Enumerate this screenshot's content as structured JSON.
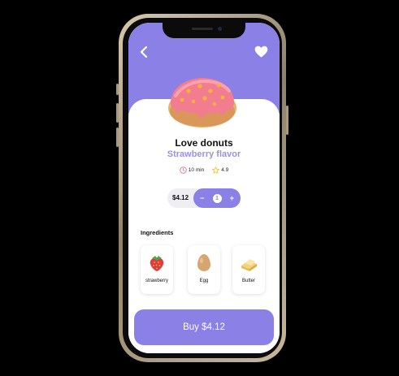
{
  "colors": {
    "accent": "#8b80e6",
    "subtitle": "#9a90e6",
    "clock": "#e07aa8",
    "star": "#f4c430",
    "background": "#000000"
  },
  "header": {
    "back_icon": "chevron-left-icon",
    "favorite_icon": "heart-icon"
  },
  "product": {
    "image": "pink-frosted-donut",
    "name": "Love donuts",
    "flavor": "Strawberry flavor",
    "time": "10 min",
    "rating": "4.9",
    "price": "$4.12",
    "quantity": "1",
    "minus": "−",
    "plus": "+"
  },
  "ingredients": {
    "title": "Ingredients",
    "items": [
      {
        "label": "strawberry",
        "icon": "strawberry-icon"
      },
      {
        "label": "Egg",
        "icon": "egg-icon"
      },
      {
        "label": "Butter",
        "icon": "butter-icon"
      }
    ]
  },
  "buy": {
    "label": "Buy $4.12"
  }
}
